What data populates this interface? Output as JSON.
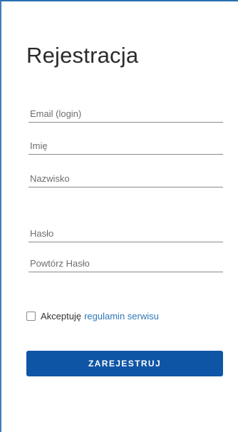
{
  "form": {
    "title": "Rejestracja",
    "fields": {
      "email": {
        "placeholder": "Email (login)",
        "value": ""
      },
      "first_name": {
        "placeholder": "Imię",
        "value": ""
      },
      "last_name": {
        "placeholder": "Nazwisko",
        "value": ""
      },
      "password": {
        "placeholder": "Hasło",
        "value": ""
      },
      "password_repeat": {
        "placeholder": "Powtórz Hasło",
        "value": ""
      }
    },
    "terms": {
      "checked": false,
      "label": "Akceptuję",
      "link_text": "regulamin serwisu"
    },
    "submit_label": "ZAREJESTRUJ"
  },
  "colors": {
    "accent": "#0f55a6",
    "link": "#2f78b5",
    "border": "#2a6fb0"
  }
}
